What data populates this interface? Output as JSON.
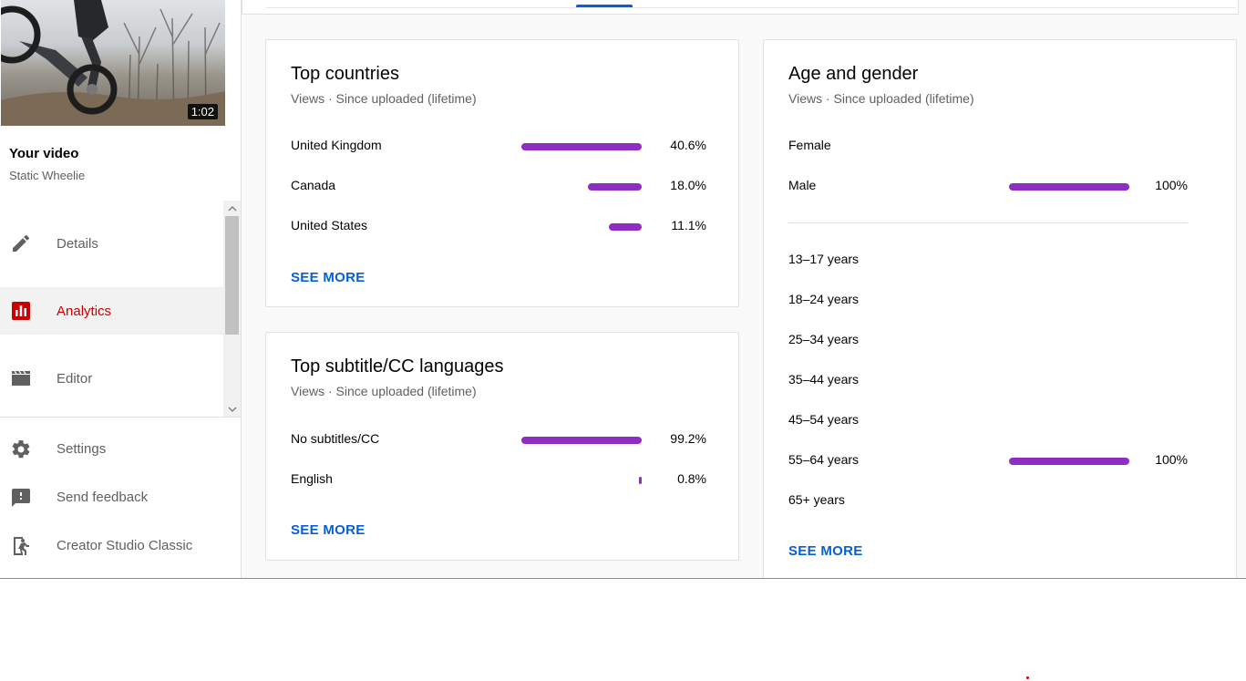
{
  "video": {
    "duration": "1:02",
    "section_title": "Your video",
    "name": "Static Wheelie"
  },
  "sidebar": {
    "nav": [
      {
        "label": "Details",
        "icon": "pencil-icon",
        "active": false
      },
      {
        "label": "Analytics",
        "icon": "analytics-icon",
        "active": true
      },
      {
        "label": "Editor",
        "icon": "clapperboard-icon",
        "active": false
      }
    ],
    "bottom": [
      {
        "label": "Settings",
        "icon": "gear-icon"
      },
      {
        "label": "Send feedback",
        "icon": "feedback-icon"
      },
      {
        "label": "Creator Studio Classic",
        "icon": "exit-icon"
      }
    ]
  },
  "top_countries": {
    "title": "Top countries",
    "subtitle": "Views · Since uploaded (lifetime)",
    "rows": [
      {
        "label": "United Kingdom",
        "value": "40.6%",
        "bar_fraction": 1.0
      },
      {
        "label": "Canada",
        "value": "18.0%",
        "bar_fraction": 0.45
      },
      {
        "label": "United States",
        "value": "11.1%",
        "bar_fraction": 0.27
      }
    ],
    "see_more": "SEE MORE"
  },
  "subtitle_languages": {
    "title": "Top subtitle/CC languages",
    "subtitle": "Views · Since uploaded (lifetime)",
    "rows": [
      {
        "label": "No subtitles/CC",
        "value": "99.2%",
        "bar_fraction": 1.0
      },
      {
        "label": "English",
        "value": "0.8%",
        "bar_fraction": 0.015
      }
    ],
    "see_more": "SEE MORE"
  },
  "age_gender": {
    "title": "Age and gender",
    "subtitle": "Views · Since uploaded (lifetime)",
    "gender": [
      {
        "label": "Female",
        "value": "",
        "bar_fraction": 0
      },
      {
        "label": "Male",
        "value": "100%",
        "bar_fraction": 1.0
      }
    ],
    "ages": [
      {
        "label": "13–17 years",
        "value": "",
        "bar_fraction": 0
      },
      {
        "label": "18–24 years",
        "value": "",
        "bar_fraction": 0
      },
      {
        "label": "25–34 years",
        "value": "",
        "bar_fraction": 0
      },
      {
        "label": "35–44 years",
        "value": "",
        "bar_fraction": 0
      },
      {
        "label": "45–54 years",
        "value": "",
        "bar_fraction": 0
      },
      {
        "label": "55–64 years",
        "value": "100%",
        "bar_fraction": 1.0
      },
      {
        "label": "65+ years",
        "value": "",
        "bar_fraction": 0
      }
    ],
    "see_more": "SEE MORE"
  },
  "colors": {
    "bar": "#8e2dc2",
    "accent_red": "#cc0000",
    "link_blue": "#065fd4"
  }
}
